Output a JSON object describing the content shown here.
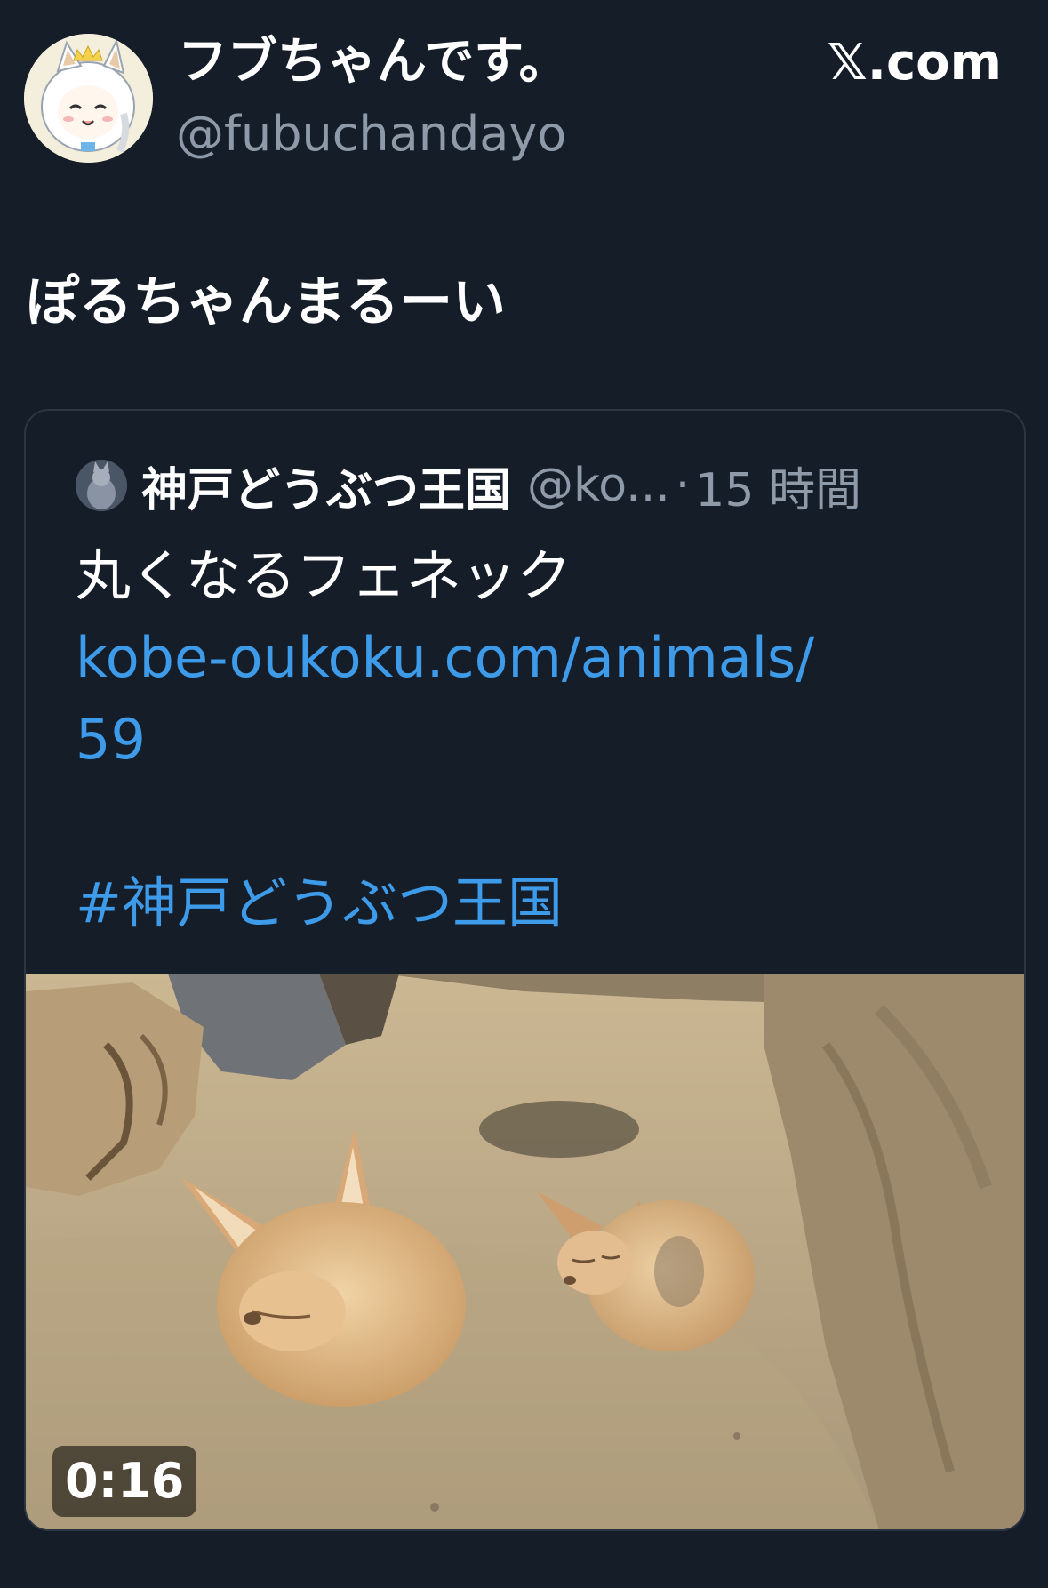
{
  "author": {
    "display_name": "フブちゃんです。",
    "handle": "@fubuchandayo"
  },
  "brand": {
    "label": "𝕏.com"
  },
  "tweet": {
    "text": "ぽるちゃんまるーい"
  },
  "quote": {
    "name": "神戸どうぶつ王国",
    "handle": "@ko...",
    "separator": "·",
    "time": "15 時間",
    "text": "丸くなるフェネック",
    "link_line1": "kobe-oukoku.com/animals/",
    "link_line2": "59",
    "hashtag": "#神戸どうぶつ王国"
  },
  "media": {
    "type": "video",
    "duration": "0:16"
  },
  "colors": {
    "background": "#151d28",
    "link": "#3d9be9",
    "secondary_text": "#8f9aa8"
  }
}
